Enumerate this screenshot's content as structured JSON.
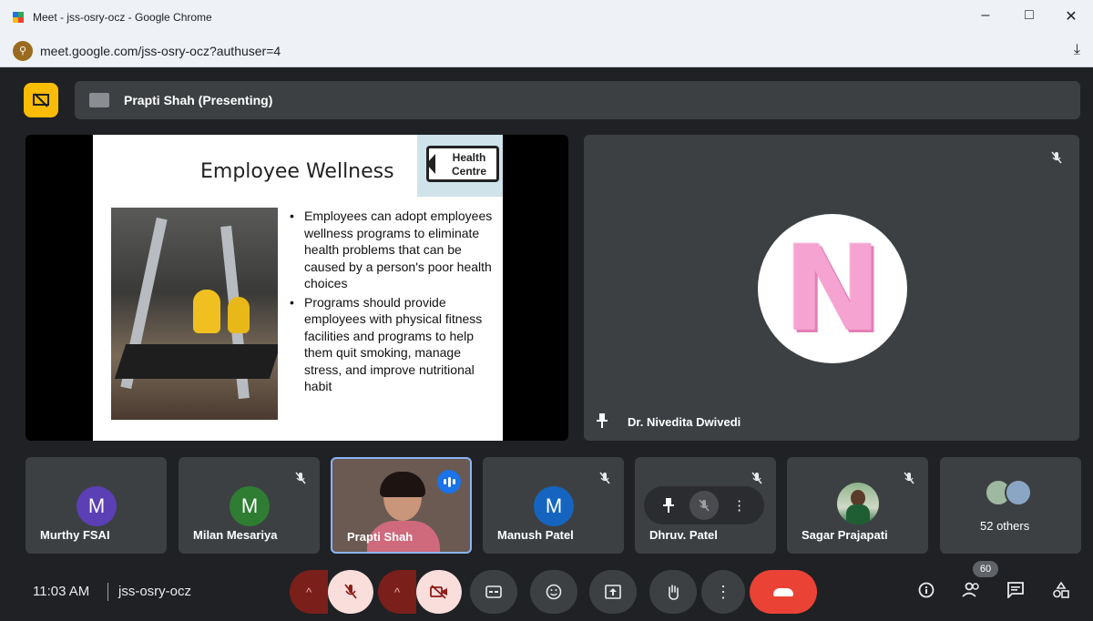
{
  "browser": {
    "window_title": "Meet - jss-osry-ocz - Google Chrome",
    "url": "meet.google.com/jss-osry-ocz?authuser=4",
    "controls": {
      "minimize": "–",
      "maximize": "□",
      "close": "✕"
    },
    "download_glyph": "⤓"
  },
  "presentation": {
    "presenter_label": "Prapti Shah (Presenting)",
    "slide": {
      "title": "Employee Wellness",
      "sign_text": [
        "Health",
        "Centre"
      ],
      "bullets": [
        "Employees can adopt employees wellness programs to eliminate health problems that can be caused by a person's poor health choices",
        "Programs should provide employees with physical fitness facilities and programs to help them quit smoking, manage stress, and improve nutritional habit"
      ]
    }
  },
  "pinned_tile": {
    "name": "Dr. Nivedita Dwivedi",
    "avatar_letter": "N",
    "muted": true
  },
  "participants": [
    {
      "name": "Murthy FSAI",
      "initial": "M",
      "avatar_color": "#5b3fb5",
      "muted": false
    },
    {
      "name": "Milan Mesariya",
      "initial": "M",
      "avatar_color": "#2e7d32",
      "muted": true
    },
    {
      "name": "Prapti Shah",
      "initial": "",
      "avatar_color": "",
      "muted": false,
      "speaking": true
    },
    {
      "name": "Manush Patel",
      "initial": "M",
      "avatar_color": "#1565c0",
      "muted": true
    },
    {
      "name": "Dhruv. Patel",
      "initial": "",
      "avatar_color": "",
      "muted": true
    },
    {
      "name": "Sagar Prajapati",
      "initial": "",
      "avatar_color": "",
      "muted": true
    }
  ],
  "others_tile": {
    "label": "52 others"
  },
  "bottom_bar": {
    "time": "11:03 AM",
    "meeting_code": "jss-osry-ocz",
    "people_count": "60"
  },
  "icons": {
    "mic_off": "🎙",
    "pin": "📌",
    "more": "⋮",
    "chevron_up": "^"
  },
  "colors": {
    "meet_bg": "#202124",
    "tile_bg": "#3c4043",
    "present_badge": "#fbbc04",
    "end_call": "#ea4335",
    "active_border": "#8ab4f8"
  }
}
